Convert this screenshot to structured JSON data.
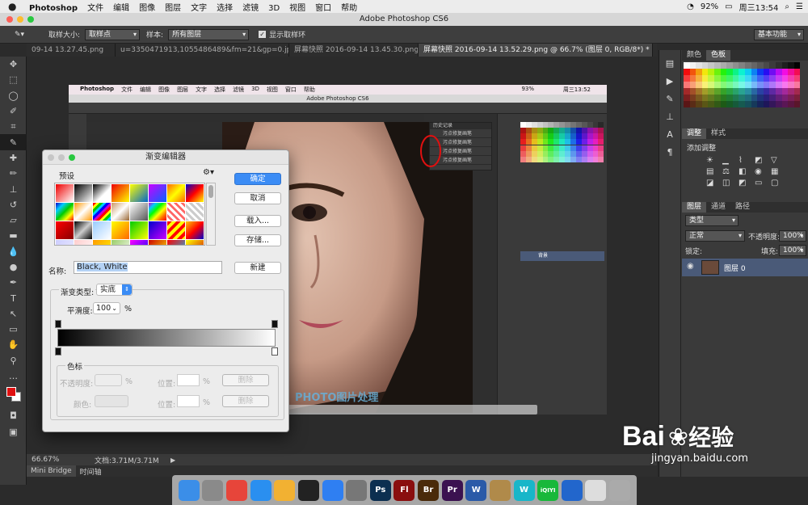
{
  "menubar": {
    "items": [
      "Photoshop",
      "文件",
      "编辑",
      "图像",
      "图层",
      "文字",
      "选择",
      "滤镜",
      "3D",
      "视图",
      "窗口",
      "帮助"
    ],
    "battery": "92%",
    "clock": "周三13:54"
  },
  "titlebar": {
    "title": "Adobe Photoshop CS6"
  },
  "options": {
    "sample_size_label": "取样大小:",
    "sample_size_value": "取样点",
    "sample_label": "样本:",
    "sample_value": "所有图层",
    "show_ring_label": "显示取样环",
    "workspace": "基本功能"
  },
  "tabs": [
    "09-14 13.27.45.png",
    "u=3350471913,1055486489&fm=21&gp=0.jpg",
    "屏幕快照 2016-09-14 13.45.30.png",
    "屏幕快照 2016-09-14 13.52.29.png @ 66.7% (图层 0, RGB/8*) *"
  ],
  "status": {
    "zoom": "66.67%",
    "doc": "文档:3.71M/3.71M"
  },
  "bottom_tabs": [
    "Mini Bridge",
    "时间轴"
  ],
  "panels": {
    "swatch_tabs": [
      "颜色",
      "色板"
    ],
    "adjust_tabs": [
      "调整",
      "样式"
    ],
    "adjust_title": "添加调整",
    "layer_tabs": [
      "图层",
      "通道",
      "路径"
    ],
    "kind": "类型",
    "blend": "正常",
    "opacity_label": "不透明度:",
    "opacity_value": "100%",
    "lock_label": "锁定:",
    "fill_label": "填充:",
    "fill_value": "100%",
    "layer_name": "图层 0"
  },
  "inner_screenshot": {
    "menu": [
      "Photoshop",
      "文件",
      "编辑",
      "图像",
      "图层",
      "文字",
      "选择",
      "滤镜",
      "3D",
      "视图",
      "窗口",
      "帮助"
    ],
    "clock": "周三13:52",
    "battery": "93%",
    "title": "Adobe Photoshop CS6",
    "history_title": "历史记录",
    "history_items": [
      "污点修复画笔",
      "污点修复画笔",
      "污点修复画笔",
      "污点修复画笔"
    ],
    "layer_name": "背景",
    "watermark": "PHOTO图片处理"
  },
  "gradient_editor": {
    "title": "渐变编辑器",
    "presets_label": "预设",
    "ok": "确定",
    "cancel": "取消",
    "load": "载入...",
    "save": "存储...",
    "name_label": "名称:",
    "name_value": "Black, White",
    "new": "新建",
    "type_label": "渐变类型:",
    "type_value": "实底",
    "smooth_label": "平滑度:",
    "smooth_value": "100",
    "smooth_unit": "%",
    "stops_label": "色标",
    "opacity_label": "不透明度:",
    "position_label": "位置:",
    "pct": "%",
    "delete": "删除",
    "color_label": "颜色:"
  },
  "watermark": {
    "brand": "Bai",
    "brand2": "经验",
    "url": "jingyan.baidu.com"
  },
  "dock": [
    {
      "name": "finder-icon",
      "label": "",
      "color": "#3b8ee8"
    },
    {
      "name": "launchpad-icon",
      "label": "",
      "color": "#8a8a8a"
    },
    {
      "name": "chrome-icon",
      "label": "",
      "color": "#e7453a"
    },
    {
      "name": "safari-icon",
      "label": "",
      "color": "#2a8ff0"
    },
    {
      "name": "photos-icon",
      "label": "",
      "color": "#f2b132"
    },
    {
      "name": "qq-icon",
      "label": "",
      "color": "#222222"
    },
    {
      "name": "appstore-icon",
      "label": "",
      "color": "#2f7ff2"
    },
    {
      "name": "settings-icon",
      "label": "",
      "color": "#777777"
    },
    {
      "name": "photoshop-icon",
      "label": "Ps",
      "color": "#0c2f50"
    },
    {
      "name": "flash-icon",
      "label": "Fl",
      "color": "#8a0f0f"
    },
    {
      "name": "bridge-icon",
      "label": "Br",
      "color": "#4a2a0a"
    },
    {
      "name": "premiere-icon",
      "label": "Pr",
      "color": "#3b1250"
    },
    {
      "name": "word-icon",
      "label": "W",
      "color": "#2a5aa8"
    },
    {
      "name": "archive-icon",
      "label": "",
      "color": "#b08a4a"
    },
    {
      "name": "wunderlist-icon",
      "label": "W",
      "color": "#18b6c9"
    },
    {
      "name": "iqiyi-icon",
      "label": "iQIYI",
      "color": "#18b83a"
    },
    {
      "name": "browser-icon",
      "label": "",
      "color": "#2266cc"
    },
    {
      "name": "preview-icon",
      "label": "",
      "color": "#dddddd"
    },
    {
      "name": "trash-icon",
      "label": "",
      "color": "#aaaaaa"
    }
  ]
}
